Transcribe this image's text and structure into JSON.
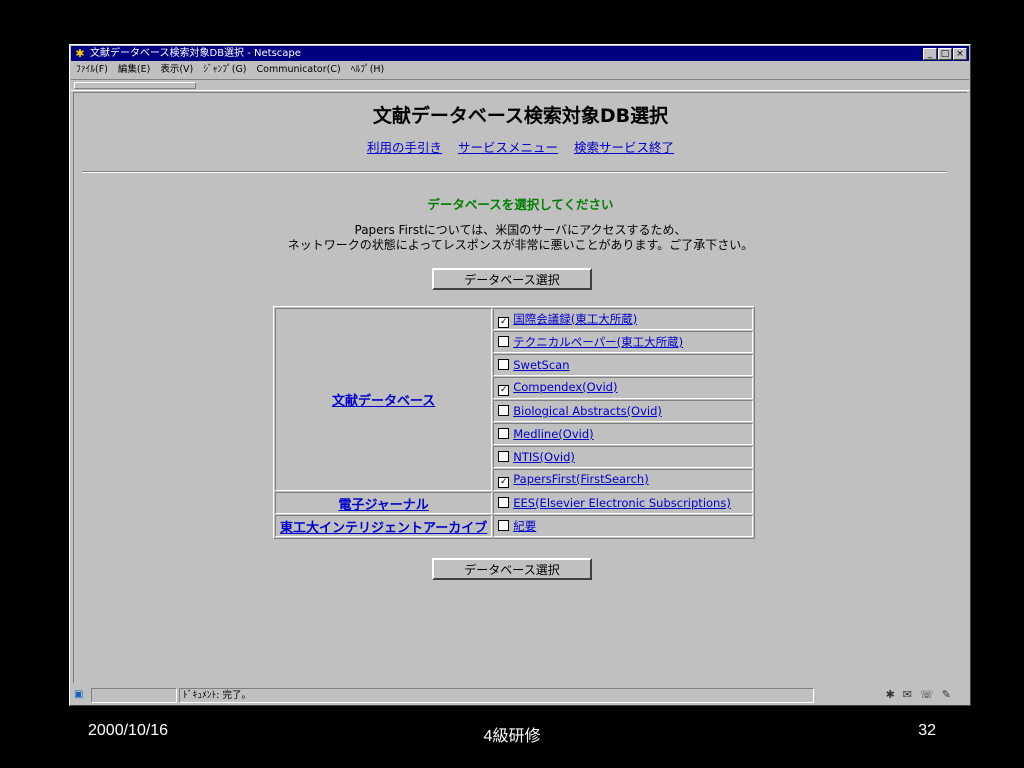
{
  "window": {
    "title": "文献データベース検索対象DB選択 - Netscape",
    "app_icon": "netscape-icon",
    "controls": [
      "_",
      "□",
      "×"
    ]
  },
  "menu": [
    "ﾌｧｲﾙ(F)",
    "編集(E)",
    "表示(V)",
    "ｼﾞｬﾝﾌﾟ(G)",
    "Communicator(C)",
    "ﾍﾙﾌﾟ(H)"
  ],
  "page": {
    "title": "文献データベース検索対象DB選択",
    "links": [
      "利用の手引き",
      "サービスメニュー",
      "検索サービス終了"
    ],
    "prompt": "データベースを選択してください",
    "notice_line1": "Papers Firstについては、米国のサーバにアクセスするため、",
    "notice_line2": "ネットワークの状態によってレスポンスが非常に悪いことがあります。ご了承下さい。",
    "select_button": "データベース選択",
    "categories": [
      {
        "label": "文献データベース",
        "items": [
          {
            "label": "国際会議録(東工大所蔵)",
            "checked": true
          },
          {
            "label": "テクニカルペーパー(東工大所蔵)",
            "checked": false
          },
          {
            "label": "SwetScan",
            "checked": false
          },
          {
            "label": "Compendex(Ovid)",
            "checked": true
          },
          {
            "label": "Biological Abstracts(Ovid)",
            "checked": false
          },
          {
            "label": "Medline(Ovid)",
            "checked": false
          },
          {
            "label": "NTIS(Ovid)",
            "checked": false
          },
          {
            "label": "PapersFirst(FirstSearch)",
            "checked": true
          }
        ]
      },
      {
        "label": "電子ジャーナル",
        "items": [
          {
            "label": "EES(Elsevier Electronic Subscriptions)",
            "checked": false
          }
        ]
      },
      {
        "label": "東工大インテリジェントアーカイブ",
        "items": [
          {
            "label": "紀要",
            "checked": false
          }
        ]
      }
    ]
  },
  "status": {
    "message": "ﾄﾞｷｭﾒﾝﾄ: 完了。"
  },
  "slide_footer": {
    "date": "2000/10/16",
    "center": "4級研修",
    "page": "32"
  }
}
